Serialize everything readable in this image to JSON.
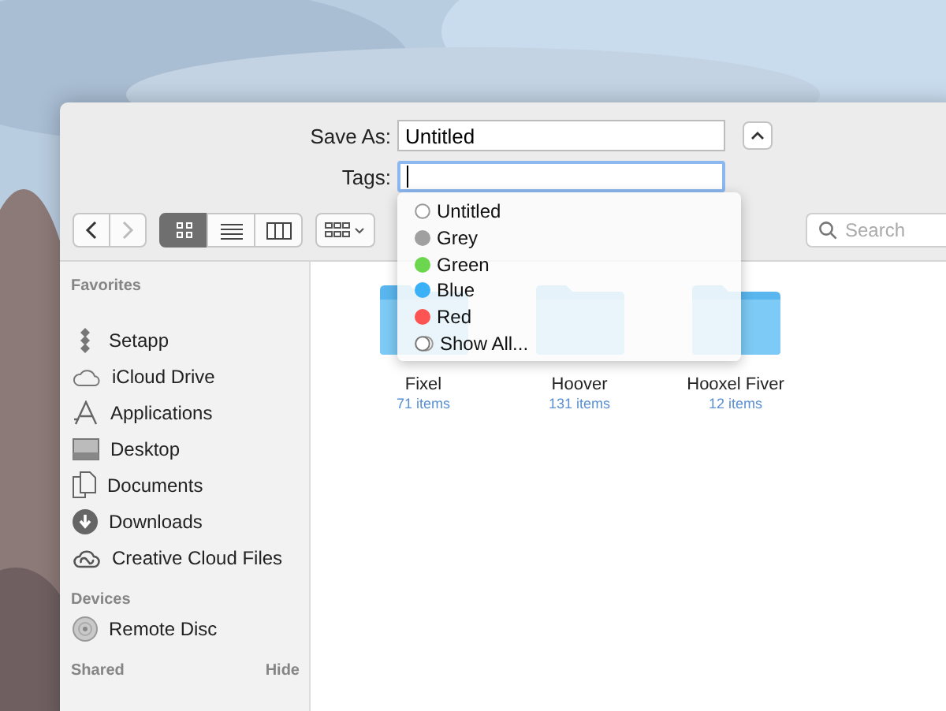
{
  "save_as": {
    "label": "Save As:",
    "value": "Untitled"
  },
  "tags": {
    "label": "Tags:"
  },
  "view_buttons": [
    {
      "selected": true
    },
    {
      "selected": false
    },
    {
      "selected": false
    }
  ],
  "search": {
    "placeholder": "Search"
  },
  "sidebar": {
    "sections": [
      {
        "title": "Favorites",
        "items": [
          "Setapp",
          "iCloud Drive",
          "Applications",
          "Desktop",
          "Documents",
          "Downloads",
          "Creative Cloud Files"
        ]
      },
      {
        "title": "Devices",
        "items": [
          "Remote Disc"
        ]
      },
      {
        "title": "Shared",
        "action": "Hide"
      }
    ]
  },
  "folders": [
    {
      "name": "Fixel",
      "count": "71 items"
    },
    {
      "name": "Hoover",
      "count": "131 items"
    },
    {
      "name": "Hooxel Fiver",
      "count": "12 items"
    }
  ],
  "tag_menu": [
    {
      "kind": "none",
      "label": "Untitled"
    },
    {
      "kind": "color",
      "label": "Grey",
      "color": "#a0a0a0"
    },
    {
      "kind": "color",
      "label": "Green",
      "color": "#6dd64f"
    },
    {
      "kind": "color",
      "label": "Blue",
      "color": "#3ab0f7"
    },
    {
      "kind": "color",
      "label": "Red",
      "color": "#fc5452"
    },
    {
      "kind": "all",
      "label": "Show All..."
    }
  ]
}
